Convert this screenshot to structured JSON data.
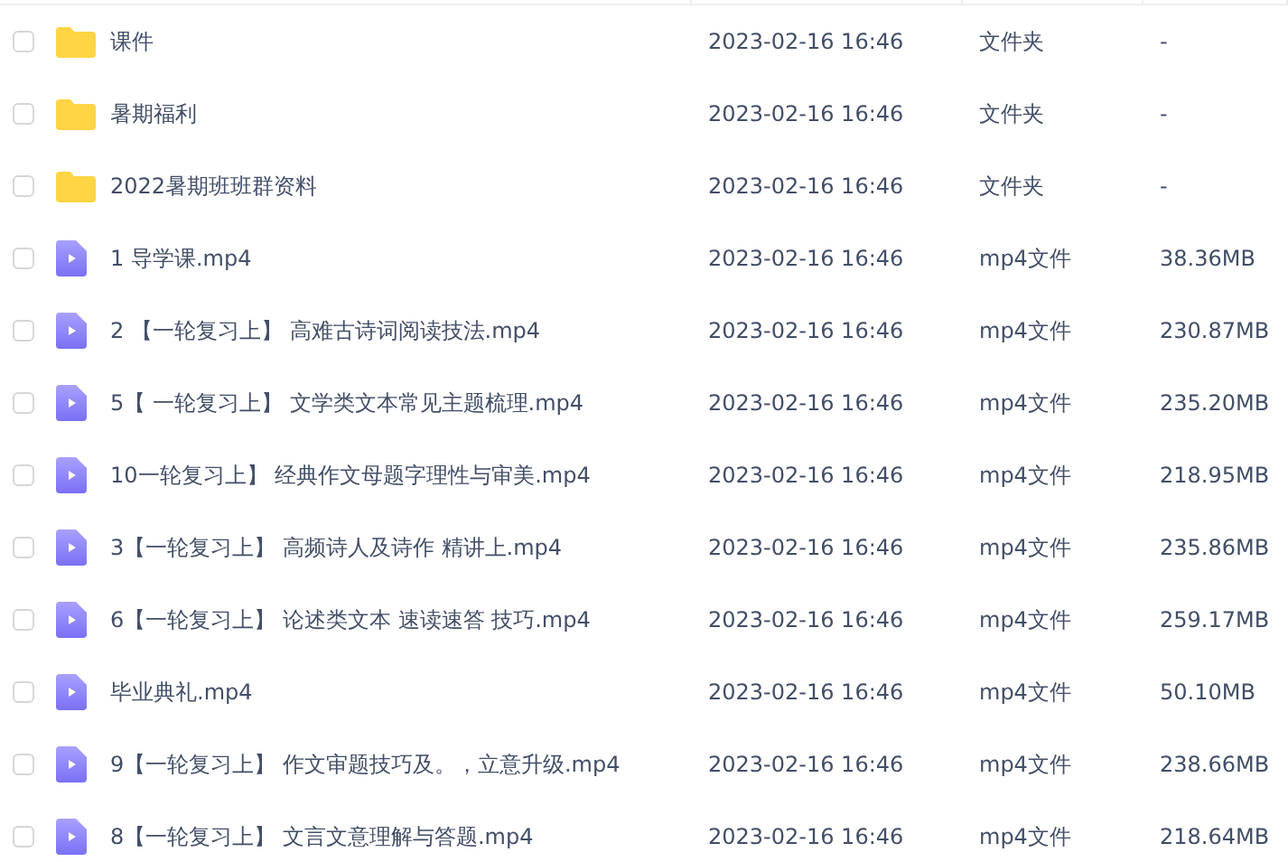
{
  "files": [
    {
      "kind": "folder",
      "checked": false,
      "name": "课件",
      "modified": "2023-02-16 16:46",
      "type": "文件夹",
      "size": "-"
    },
    {
      "kind": "folder",
      "checked": false,
      "name": "暑期福利",
      "modified": "2023-02-16 16:46",
      "type": "文件夹",
      "size": "-"
    },
    {
      "kind": "folder",
      "checked": false,
      "name": "2022暑期班班群资料",
      "modified": "2023-02-16 16:46",
      "type": "文件夹",
      "size": "-"
    },
    {
      "kind": "video",
      "checked": false,
      "name": "1  导学课.mp4",
      "modified": "2023-02-16 16:46",
      "type": "mp4文件",
      "size": "38.36MB"
    },
    {
      "kind": "video",
      "checked": false,
      "name": "2 【一轮复习上】  高难古诗词阅读技法.mp4",
      "modified": "2023-02-16 16:46",
      "type": "mp4文件",
      "size": "230.87MB"
    },
    {
      "kind": "video",
      "checked": false,
      "name": "5【 一轮复习上】  文学类文本常见主题梳理.mp4",
      "modified": "2023-02-16 16:46",
      "type": "mp4文件",
      "size": "235.20MB"
    },
    {
      "kind": "video",
      "checked": false,
      "name": "10一轮复习上】 经典作文母题字理性与审美.mp4",
      "modified": "2023-02-16 16:46",
      "type": "mp4文件",
      "size": "218.95MB"
    },
    {
      "kind": "video",
      "checked": false,
      "name": "3【一轮复习上】  高频诗人及诗作 精讲上.mp4",
      "modified": "2023-02-16 16:46",
      "type": "mp4文件",
      "size": "235.86MB"
    },
    {
      "kind": "video",
      "checked": false,
      "name": "6【一轮复习上】  论述类文本  速读速答  技巧.mp4",
      "modified": "2023-02-16 16:46",
      "type": "mp4文件",
      "size": "259.17MB"
    },
    {
      "kind": "video",
      "checked": false,
      "name": "毕业典礼.mp4",
      "modified": "2023-02-16 16:46",
      "type": "mp4文件",
      "size": "50.10MB"
    },
    {
      "kind": "video",
      "checked": false,
      "name": "9【一轮复习上】  作文审题技巧及。，立意升级.mp4",
      "modified": "2023-02-16 16:46",
      "type": "mp4文件",
      "size": "238.66MB"
    },
    {
      "kind": "video",
      "checked": false,
      "name": "8【一轮复习上】  文言文意理解与答题.mp4",
      "modified": "2023-02-16 16:46",
      "type": "mp4文件",
      "size": "218.64MB"
    }
  ]
}
